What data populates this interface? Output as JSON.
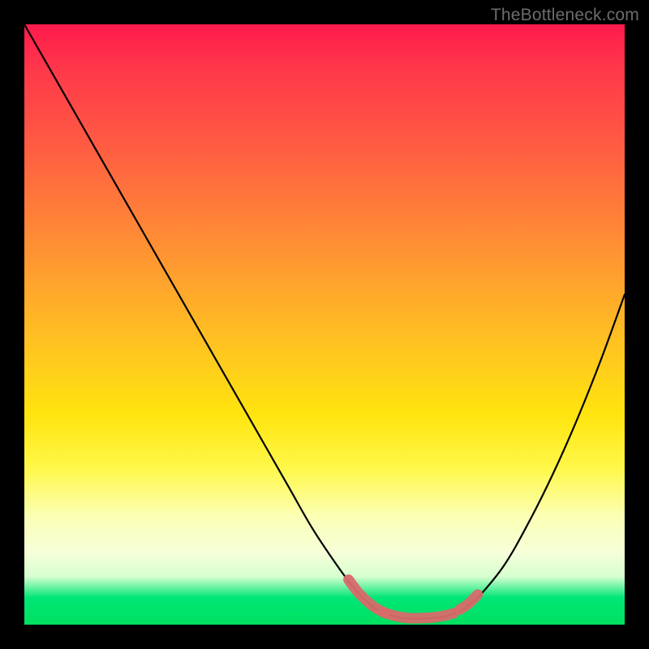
{
  "watermark": "TheBottleneck.com",
  "chart_data": {
    "type": "line",
    "title": "",
    "xlabel": "",
    "ylabel": "",
    "x_range": [
      0,
      100
    ],
    "y_range": [
      0,
      100
    ],
    "series": [
      {
        "name": "curve",
        "x": [
          0,
          4,
          8,
          12,
          16,
          20,
          24,
          28,
          32,
          36,
          40,
          44,
          48,
          52,
          55,
          58,
          60,
          62,
          64,
          66,
          68,
          70,
          72,
          74,
          76,
          80,
          84,
          88,
          92,
          96,
          100
        ],
        "y": [
          100,
          93,
          86,
          79,
          72,
          65,
          58,
          51,
          44,
          37,
          30,
          23,
          16,
          10,
          6,
          3,
          2,
          1.3,
          1,
          1,
          1.1,
          1.4,
          2,
          3.2,
          5,
          10,
          17,
          25,
          34,
          44,
          55
        ]
      }
    ],
    "highlight_segments": [
      {
        "name": "left-knee",
        "x": [
          54,
          55.5,
          57,
          58.5,
          60
        ],
        "y": [
          7.5,
          5.5,
          4,
          2.8,
          2
        ]
      },
      {
        "name": "floor",
        "x": [
          60,
          62,
          64,
          66,
          68,
          70,
          71.5
        ],
        "y": [
          2,
          1.4,
          1.1,
          1.1,
          1.2,
          1.5,
          1.9
        ]
      },
      {
        "name": "right-knee",
        "x": [
          72.5,
          74,
          75.5
        ],
        "y": [
          2.5,
          3.5,
          5
        ]
      }
    ],
    "colors": {
      "curve": "#000000",
      "highlight": "#d86a6a",
      "background_top": "#ff1a4d",
      "background_mid": "#ffe40e",
      "background_bottom": "#00e060"
    }
  }
}
